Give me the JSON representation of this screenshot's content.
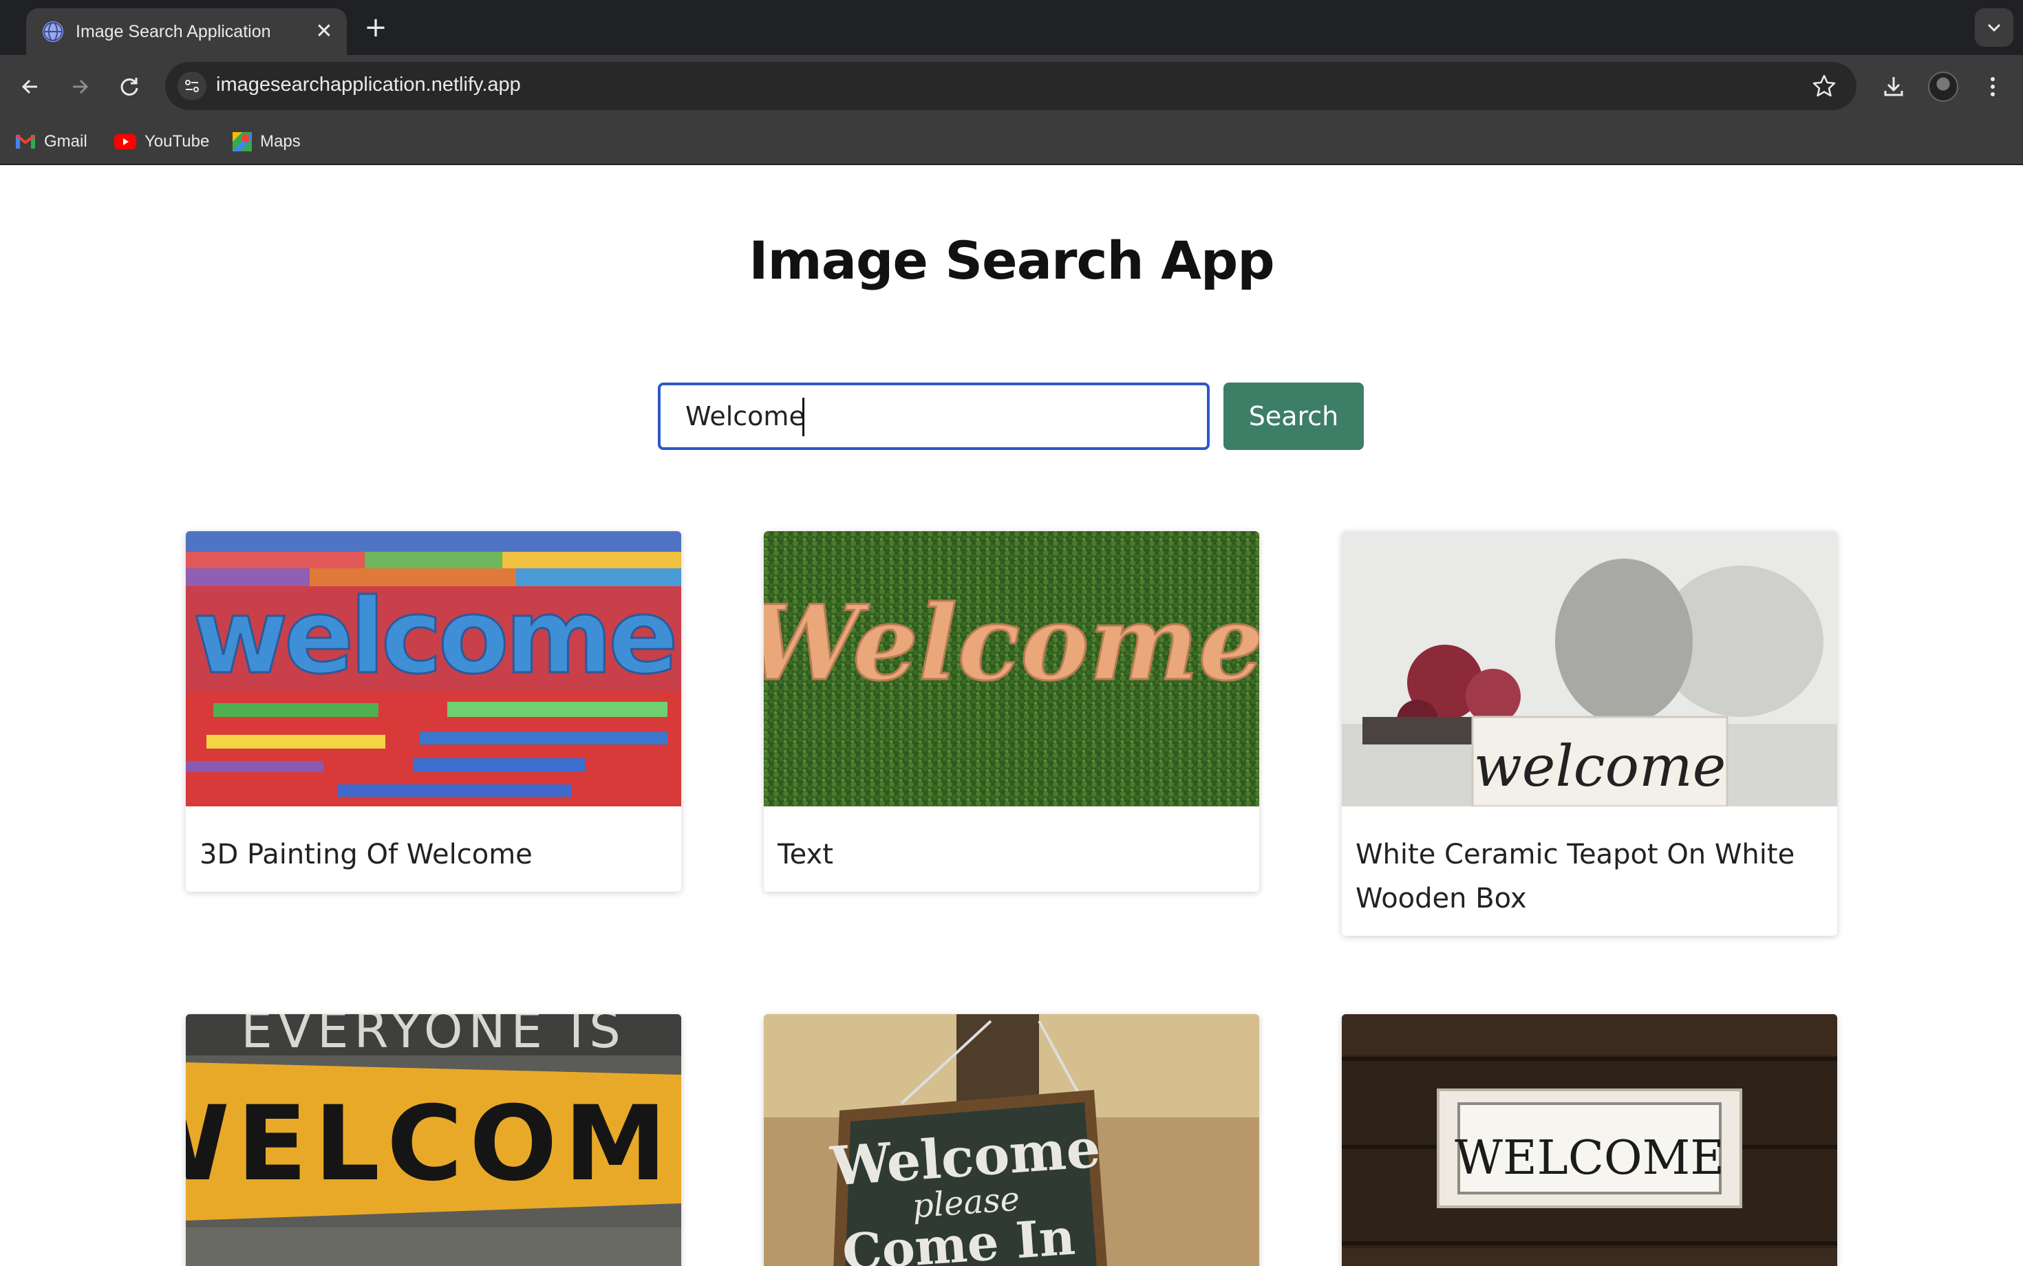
{
  "browser": {
    "tab_title": "Image Search Application",
    "tab_close": "✕",
    "new_tab": "+",
    "url": "imagesearchapplication.netlify.app",
    "bookmarks": [
      {
        "label": "Gmail",
        "icon": "gmail-icon"
      },
      {
        "label": "YouTube",
        "icon": "youtube-icon"
      },
      {
        "label": "Maps",
        "icon": "maps-icon"
      }
    ]
  },
  "app": {
    "title": "Image Search App",
    "search_value": "Welcome",
    "search_button": "Search",
    "accent_color": "#3d7e67",
    "results": [
      {
        "caption": "3D Painting Of Welcome",
        "image": "colorful-welcome-painting"
      },
      {
        "caption": "Text",
        "image": "welcome-on-green-hedge"
      },
      {
        "caption": "White Ceramic Teapot On White Wooden Box",
        "image": "welcome-sign-with-teapot"
      },
      {
        "caption": "",
        "image": "yellow-welcome-board"
      },
      {
        "caption": "",
        "image": "welcome-please-come-in-chalkboard"
      },
      {
        "caption": "",
        "image": "white-welcome-plaque-on-wood"
      }
    ]
  }
}
